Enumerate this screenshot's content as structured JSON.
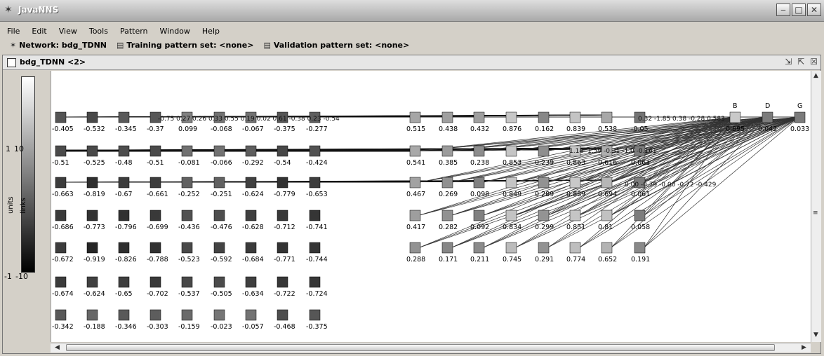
{
  "app": {
    "title": "JavaNNS",
    "icon": "network-icon"
  },
  "window_controls": [
    "minimize-icon",
    "maximize-icon",
    "close-icon"
  ],
  "menu": [
    {
      "label": "File"
    },
    {
      "label": "Edit"
    },
    {
      "label": "View"
    },
    {
      "label": "Tools"
    },
    {
      "label": "Pattern"
    },
    {
      "label": "Window"
    },
    {
      "label": "Help"
    }
  ],
  "status": {
    "network": "Network: bdg_TDNN",
    "training": "Training pattern set: <none>",
    "validation": "Validation pattern set: <none>"
  },
  "inner_window": {
    "title": "bdg_TDNN <2>"
  },
  "legend": {
    "units_label": "units",
    "links_label": "links",
    "units_top": "1",
    "units_bottom": "-1",
    "links_top": "10",
    "links_bottom": "-10"
  },
  "network": {
    "input_layer": [
      [
        "-0.405",
        "-0.532",
        "-0.345",
        "-0.37",
        "0.099",
        "-0.068",
        "-0.067",
        "-0.375",
        "-0.277"
      ],
      [
        "-0.51",
        "-0.525",
        "-0.48",
        "-0.51",
        "-0.081",
        "-0.066",
        "-0.292",
        "-0.54",
        "-0.424"
      ],
      [
        "-0.663",
        "-0.819",
        "-0.67",
        "-0.661",
        "-0.252",
        "-0.251",
        "-0.624",
        "-0.779",
        "-0.653"
      ],
      [
        "-0.686",
        "-0.773",
        "-0.796",
        "-0.699",
        "-0.436",
        "-0.476",
        "-0.628",
        "-0.712",
        "-0.741"
      ],
      [
        "-0.672",
        "-0.919",
        "-0.826",
        "-0.788",
        "-0.523",
        "-0.592",
        "-0.684",
        "-0.771",
        "-0.744"
      ],
      [
        "-0.674",
        "-0.624",
        "-0.65",
        "-0.702",
        "-0.537",
        "-0.505",
        "-0.634",
        "-0.722",
        "-0.724"
      ],
      [
        "-0.342",
        "-0.188",
        "-0.346",
        "-0.303",
        "-0.159",
        "-0.023",
        "-0.057",
        "-0.468",
        "-0.375"
      ]
    ],
    "hidden_layer": [
      [
        "0.515",
        "0.438",
        "0.432",
        "0.876",
        "0.162",
        "0.839",
        "0.538",
        "-0.05"
      ],
      [
        "0.541",
        "0.385",
        "0.238",
        "0.853",
        "0.239",
        "0.863",
        "0.616",
        "0.061"
      ],
      [
        "0.467",
        "0.269",
        "0.098",
        "0.849",
        "0.289",
        "0.889",
        "0.694",
        "0.061"
      ],
      [
        "0.417",
        "0.282",
        "0.092",
        "0.834",
        "0.299",
        "0.851",
        "0.81",
        "0.058"
      ],
      [
        "0.288",
        "0.171",
        "0.211",
        "0.745",
        "0.291",
        "0.774",
        "0.652",
        "0.191"
      ]
    ],
    "output_layer": [
      {
        "label": "B",
        "value": "0.895"
      },
      {
        "label": "D",
        "value": "0.042"
      },
      {
        "label": "G",
        "value": "0.033"
      }
    ],
    "overlapping_weight_text": [
      "-0.75 0.27 0.26 0.33 0.55 0.19 0.02 0.61 -0.38 0.23 -0.54",
      "0.32 -1.85 0.38 -0.28 0.583",
      "1.14 -1.59 -0.31 -1.0 -0.161",
      "0.00 -0.79 -0.00 -0.72 -0.429"
    ]
  }
}
